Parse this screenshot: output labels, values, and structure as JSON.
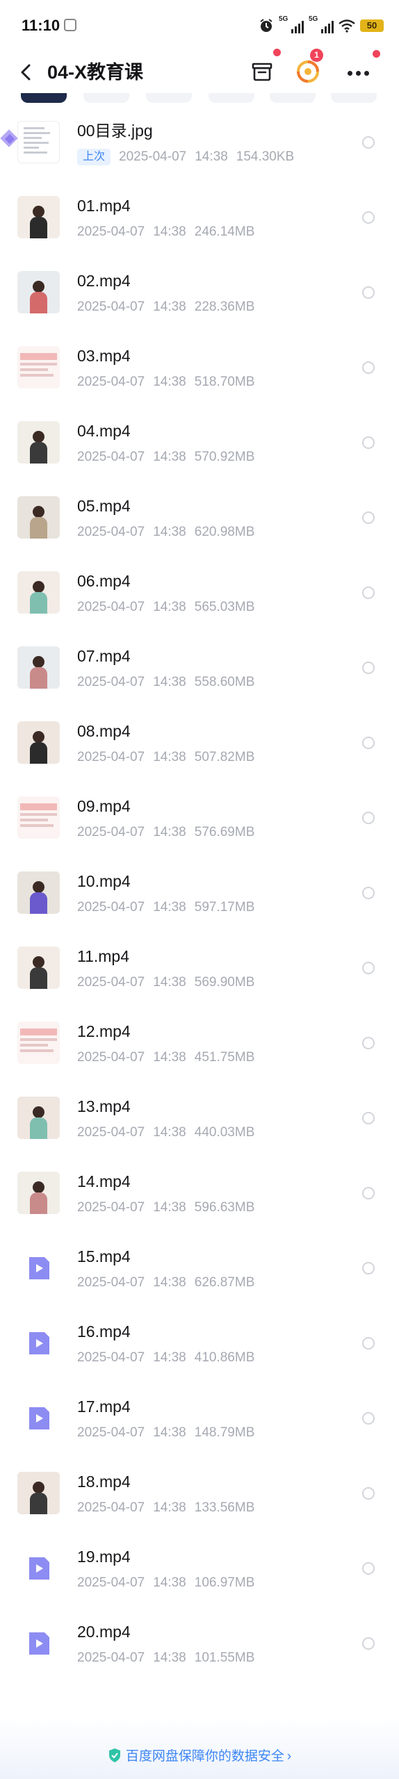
{
  "status_bar": {
    "time": "11:10",
    "signal1_label": "5G",
    "signal2_label": "5G",
    "battery": "50"
  },
  "header": {
    "title": "04-X教育课",
    "sync_badge_count": "1"
  },
  "files": [
    {
      "name": "00目录.jpg",
      "badge": "上次",
      "date": "2025-04-07",
      "time": "14:38",
      "size": "154.30KB",
      "thumb": "doc"
    },
    {
      "name": "01.mp4",
      "date": "2025-04-07",
      "time": "14:38",
      "size": "246.14MB",
      "thumb": "video"
    },
    {
      "name": "02.mp4",
      "date": "2025-04-07",
      "time": "14:38",
      "size": "228.36MB",
      "thumb": "video"
    },
    {
      "name": "03.mp4",
      "date": "2025-04-07",
      "time": "14:38",
      "size": "518.70MB",
      "thumb": "slide"
    },
    {
      "name": "04.mp4",
      "date": "2025-04-07",
      "time": "14:38",
      "size": "570.92MB",
      "thumb": "video"
    },
    {
      "name": "05.mp4",
      "date": "2025-04-07",
      "time": "14:38",
      "size": "620.98MB",
      "thumb": "video"
    },
    {
      "name": "06.mp4",
      "date": "2025-04-07",
      "time": "14:38",
      "size": "565.03MB",
      "thumb": "video"
    },
    {
      "name": "07.mp4",
      "date": "2025-04-07",
      "time": "14:38",
      "size": "558.60MB",
      "thumb": "video"
    },
    {
      "name": "08.mp4",
      "date": "2025-04-07",
      "time": "14:38",
      "size": "507.82MB",
      "thumb": "video"
    },
    {
      "name": "09.mp4",
      "date": "2025-04-07",
      "time": "14:38",
      "size": "576.69MB",
      "thumb": "slide"
    },
    {
      "name": "10.mp4",
      "date": "2025-04-07",
      "time": "14:38",
      "size": "597.17MB",
      "thumb": "video"
    },
    {
      "name": "11.mp4",
      "date": "2025-04-07",
      "time": "14:38",
      "size": "569.90MB",
      "thumb": "video"
    },
    {
      "name": "12.mp4",
      "date": "2025-04-07",
      "time": "14:38",
      "size": "451.75MB",
      "thumb": "slide"
    },
    {
      "name": "13.mp4",
      "date": "2025-04-07",
      "time": "14:38",
      "size": "440.03MB",
      "thumb": "video"
    },
    {
      "name": "14.mp4",
      "date": "2025-04-07",
      "time": "14:38",
      "size": "596.63MB",
      "thumb": "video"
    },
    {
      "name": "15.mp4",
      "date": "2025-04-07",
      "time": "14:38",
      "size": "626.87MB",
      "thumb": "icon"
    },
    {
      "name": "16.mp4",
      "date": "2025-04-07",
      "time": "14:38",
      "size": "410.86MB",
      "thumb": "icon"
    },
    {
      "name": "17.mp4",
      "date": "2025-04-07",
      "time": "14:38",
      "size": "148.79MB",
      "thumb": "icon"
    },
    {
      "name": "18.mp4",
      "date": "2025-04-07",
      "time": "14:38",
      "size": "133.56MB",
      "thumb": "video"
    },
    {
      "name": "19.mp4",
      "date": "2025-04-07",
      "time": "14:38",
      "size": "106.97MB",
      "thumb": "icon"
    },
    {
      "name": "20.mp4",
      "date": "2025-04-07",
      "time": "14:38",
      "size": "101.55MB",
      "thumb": "icon"
    }
  ],
  "footer": {
    "security_text": "百度网盘保障你的数据安全"
  },
  "colors": {
    "accent": "#3d86f5",
    "badge_red": "#f0445a",
    "meta_gray": "#a6a9b2",
    "video_icon": "#8d8cf2"
  }
}
